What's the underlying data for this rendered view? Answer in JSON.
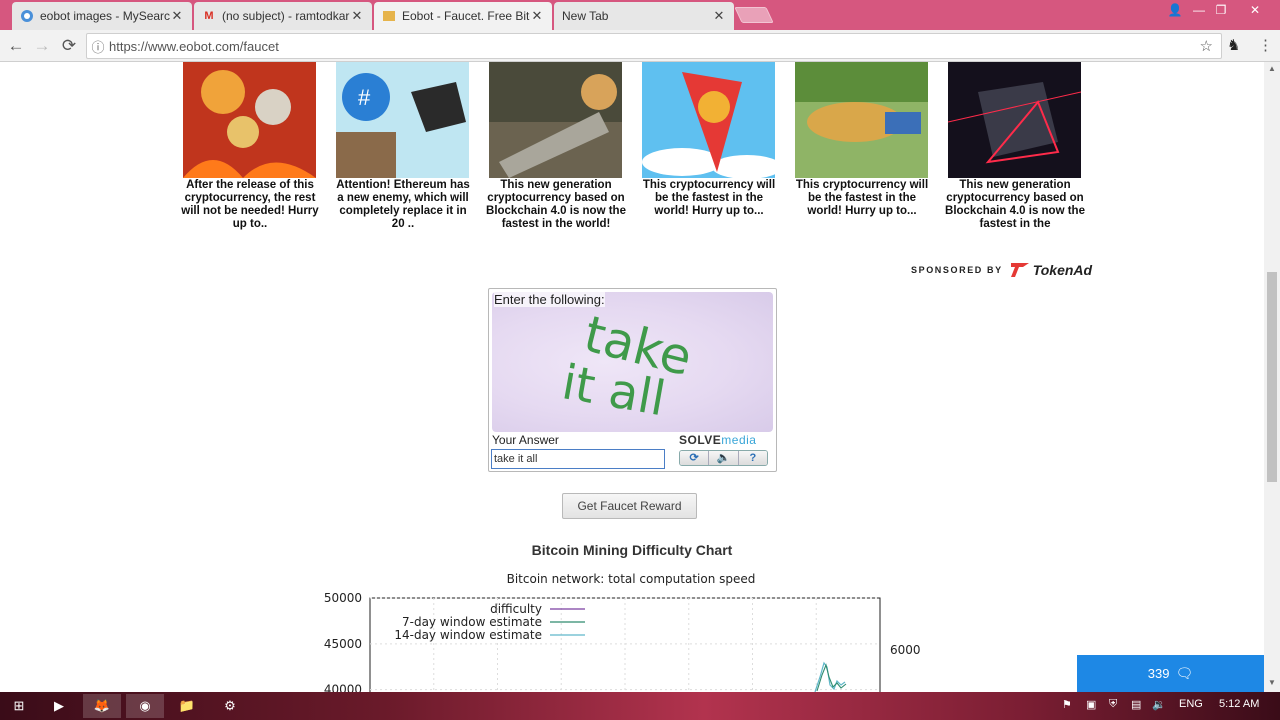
{
  "browser": {
    "tabs": [
      {
        "title": "eobot images - MySearch",
        "icon": "mysearch-icon"
      },
      {
        "title": "(no subject) - ramtodkar",
        "icon": "gmail-icon"
      },
      {
        "title": "Eobot - Faucet. Free Bitco",
        "icon": "eobot-icon"
      },
      {
        "title": "New Tab",
        "icon": ""
      }
    ],
    "url": "https://www.eobot.com/faucet"
  },
  "ads": [
    {
      "caption": "After the release of this cryptocurrency, the rest will not be needed! Hurry up to..",
      "thumb": "coins-fire"
    },
    {
      "caption": "Attention! Ethereum has a new enemy, which will completely replace it in 20 ..",
      "thumb": "cartoon-coin"
    },
    {
      "caption": "This new generation cryptocurrency based on Blockchain 4.0 is now the fastest in the world!",
      "thumb": "doge-rocket"
    },
    {
      "caption": "This cryptocurrency will be the fastest in the world! Hurry up to...",
      "thumb": "coin-rocket"
    },
    {
      "caption": "This cryptocurrency will be the fastest in the world! Hurry up to...",
      "thumb": "cheetah"
    },
    {
      "caption": "This new generation cryptocurrency based on Blockchain 4.0 is now the fastest in the",
      "thumb": "neon-crystal"
    }
  ],
  "sponsored": {
    "label": "SPONSORED BY",
    "brand": "TokenAd"
  },
  "captcha": {
    "prompt": "Enter the following:",
    "word1": "take",
    "word2": "it all",
    "your_answer_label": "Your Answer",
    "brand_solve": "SOLVE",
    "brand_media": "media",
    "answer_value": "take it all",
    "refresh_glyph": "⟳",
    "audio_glyph": "🔈",
    "help_glyph": "?"
  },
  "reward_button": "Get Faucet Reward",
  "chart_title": "Bitcoin Mining Difficulty Chart",
  "chart_data": {
    "type": "line",
    "title": "Bitcoin network: total computation speed",
    "y_ticks": [
      "50000",
      "45000",
      "40000"
    ],
    "y_right_ticks": [
      "6000"
    ],
    "ylim": [
      38000,
      50000
    ],
    "series": [
      {
        "name": "difficulty",
        "color": "#7a3fa0"
      },
      {
        "name": "7-day window estimate",
        "color": "#2e8b6e"
      },
      {
        "name": "14-day window estimate",
        "color": "#5fb7c9"
      }
    ],
    "legend": "top-left",
    "grid": true
  },
  "chat": {
    "count": "339"
  },
  "taskbar": {
    "lang": "ENG",
    "time": "5:12 AM"
  }
}
